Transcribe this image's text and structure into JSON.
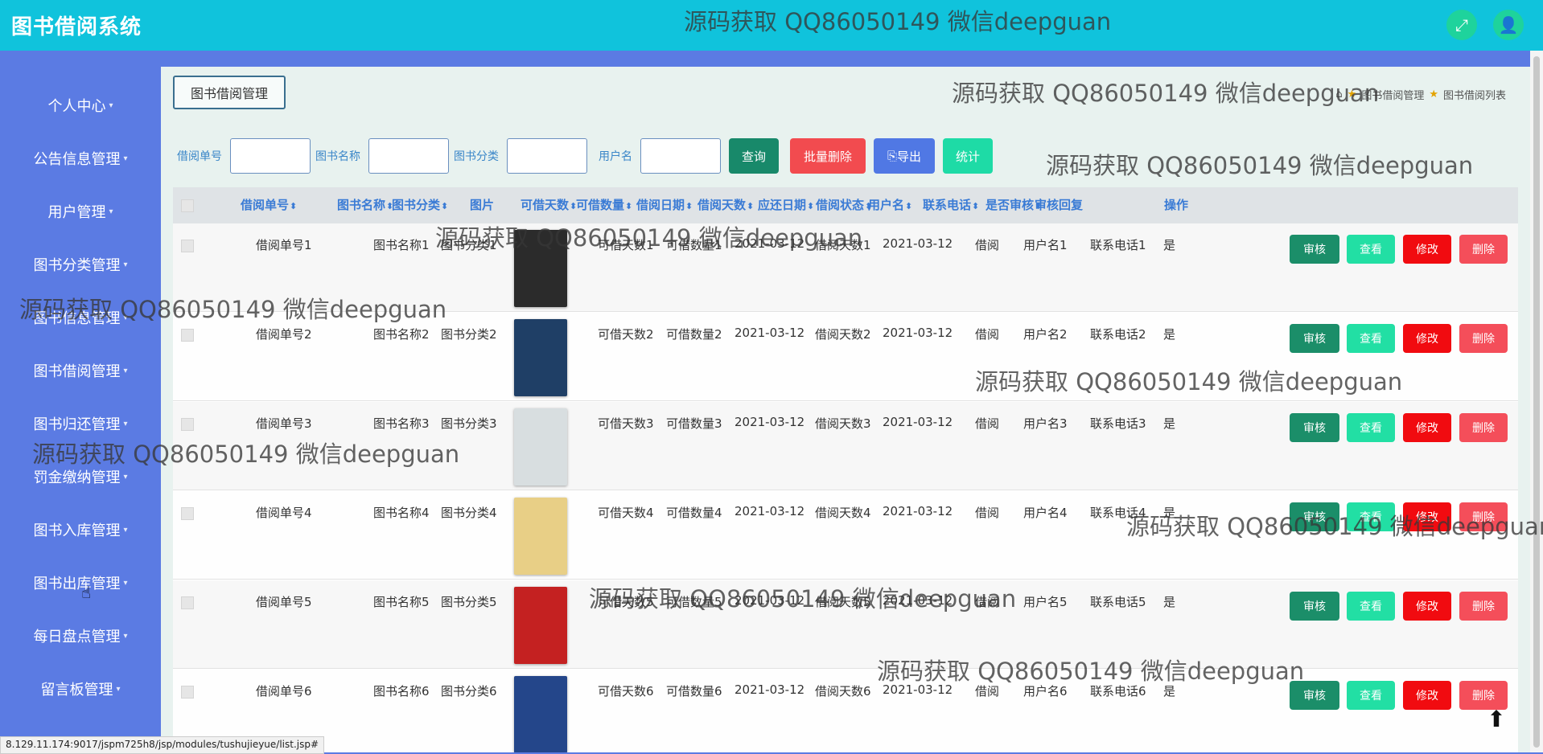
{
  "app": {
    "title": "图书借阅系统"
  },
  "watermark": "源码获取 QQ86050149 微信deepguan",
  "header_icons": [
    "fullscreen-icon",
    "user-icon"
  ],
  "sidebar": {
    "items": [
      {
        "label": "个人中心"
      },
      {
        "label": "公告信息管理"
      },
      {
        "label": "用户管理"
      },
      {
        "label": "图书分类管理"
      },
      {
        "label": "图书信息管理"
      },
      {
        "label": "图书借阅管理"
      },
      {
        "label": "图书归还管理"
      },
      {
        "label": "罚金缴纳管理"
      },
      {
        "label": "图书入库管理"
      },
      {
        "label": "图书出库管理"
      },
      {
        "label": "每日盘点管理"
      },
      {
        "label": "留言板管理"
      }
    ]
  },
  "page": {
    "tag": "图书借阅管理",
    "breadcrumb": [
      "图书借阅管理",
      "图书借阅列表"
    ]
  },
  "search": {
    "labels": [
      "借阅单号",
      "图书名称",
      "图书分类",
      "用户名"
    ],
    "buttons": {
      "query": "查询",
      "batch_delete": "批量删除",
      "export": "导出",
      "stats": "统计"
    }
  },
  "table": {
    "headers": [
      "借阅单号",
      "图书名称",
      "图书分类",
      "图片",
      "可借天数",
      "可借数量",
      "借阅日期",
      "借阅天数",
      "应还日期",
      "借阅状态",
      "用户名",
      "联系电话",
      "是否审核",
      "审核回复",
      "操作"
    ],
    "row_actions": {
      "audit": "审核",
      "view": "查看",
      "edit": "修改",
      "delete": "删除"
    },
    "rows": [
      {
        "id": "借阅单号1",
        "name": "图书名称1",
        "category": "图书分类1",
        "days": "可借天数1",
        "qty": "可借数量1",
        "borrow_date": "2021-03-12",
        "borrow_days": "借阅天数1",
        "due_date": "2021-03-12",
        "status": "借阅",
        "user": "用户名1",
        "phone": "联系电话1",
        "audited": "是",
        "reply": ""
      },
      {
        "id": "借阅单号2",
        "name": "图书名称2",
        "category": "图书分类2",
        "days": "可借天数2",
        "qty": "可借数量2",
        "borrow_date": "2021-03-12",
        "borrow_days": "借阅天数2",
        "due_date": "2021-03-12",
        "status": "借阅",
        "user": "用户名2",
        "phone": "联系电话2",
        "audited": "是",
        "reply": ""
      },
      {
        "id": "借阅单号3",
        "name": "图书名称3",
        "category": "图书分类3",
        "days": "可借天数3",
        "qty": "可借数量3",
        "borrow_date": "2021-03-12",
        "borrow_days": "借阅天数3",
        "due_date": "2021-03-12",
        "status": "借阅",
        "user": "用户名3",
        "phone": "联系电话3",
        "audited": "是",
        "reply": ""
      },
      {
        "id": "借阅单号4",
        "name": "图书名称4",
        "category": "图书分类4",
        "days": "可借天数4",
        "qty": "可借数量4",
        "borrow_date": "2021-03-12",
        "borrow_days": "借阅天数4",
        "due_date": "2021-03-12",
        "status": "借阅",
        "user": "用户名4",
        "phone": "联系电话4",
        "audited": "是",
        "reply": ""
      },
      {
        "id": "借阅单号5",
        "name": "图书名称5",
        "category": "图书分类5",
        "days": "可借天数5",
        "qty": "可借数量5",
        "borrow_date": "2021-03-12",
        "borrow_days": "借阅天数5",
        "due_date": "2021-03-12",
        "status": "借阅",
        "user": "用户名5",
        "phone": "联系电话5",
        "audited": "是",
        "reply": ""
      },
      {
        "id": "借阅单号6",
        "name": "图书名称6",
        "category": "图书分类6",
        "days": "可借天数6",
        "qty": "可借数量6",
        "borrow_date": "2021-03-12",
        "borrow_days": "借阅天数6",
        "due_date": "2021-03-12",
        "status": "借阅",
        "user": "用户名6",
        "phone": "联系电话6",
        "audited": "是",
        "reply": ""
      }
    ]
  },
  "book_cover_colors": [
    "#2b2b2b",
    "#1f3f66",
    "#d8dee0",
    "#e8cf86",
    "#c42121",
    "#24468a"
  ],
  "status_bar": "8.129.11.174:9017/jspm725h8/jsp/modules/tushujieyue/list.jsp#"
}
